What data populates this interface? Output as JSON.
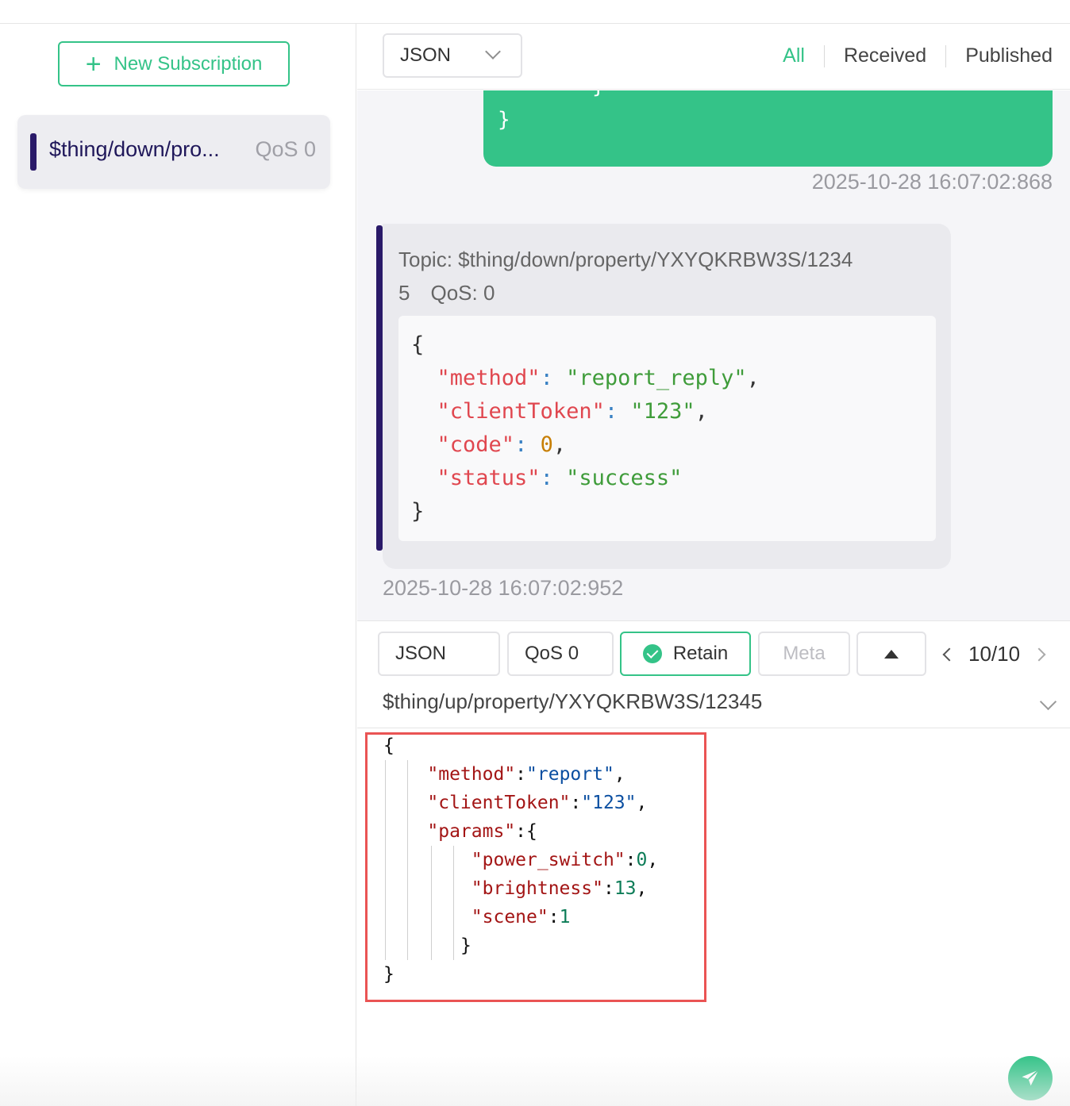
{
  "sidebar": {
    "new_subscription_label": "New Subscription",
    "subscriptions": [
      {
        "topic": "$thing/down/pro...",
        "qos": "QoS 0",
        "color": "#2a1a69"
      }
    ]
  },
  "header": {
    "format": "JSON",
    "filters": [
      "All",
      "Received",
      "Published"
    ],
    "active_filter": "All"
  },
  "messages": {
    "published": {
      "lines": [
        "}",
        "}"
      ],
      "timestamp": "2025-10-28 16:07:02:868"
    },
    "received": {
      "topic_line1": "Topic: $thing/down/property/YXYQKRBW3S/1234",
      "topic_line2": "5",
      "qos": "QoS: 0",
      "payload": {
        "open": "{",
        "method_key": "\"method\"",
        "method_val": "\"report_reply\"",
        "token_key": "\"clientToken\"",
        "token_val": "\"123\"",
        "code_key": "\"code\"",
        "code_val": "0",
        "status_key": "\"status\"",
        "status_val": "\"success\"",
        "close": "}"
      },
      "timestamp": "2025-10-28 16:07:02:952"
    }
  },
  "publish": {
    "format": "JSON",
    "qos": "QoS 0",
    "retain_label": "Retain",
    "meta_label": "Meta",
    "pager": "10/10",
    "topic": "$thing/up/property/YXYQKRBW3S/12345",
    "payload": {
      "open": "{",
      "method_key": "\"method\"",
      "method_val": "\"report\"",
      "token_key": "\"clientToken\"",
      "token_val": "\"123\"",
      "params_key": "\"params\"",
      "power_key": "\"power_switch\"",
      "power_val": "0",
      "bright_key": "\"brightness\"",
      "bright_val": "13",
      "scene_key": "\"scene\"",
      "scene_val": "1",
      "inner_close": "}",
      "close": "}"
    }
  },
  "colors": {
    "accent": "#34c388",
    "subscription_bar": "#2a1a69",
    "highlight_border": "#ea5454"
  }
}
